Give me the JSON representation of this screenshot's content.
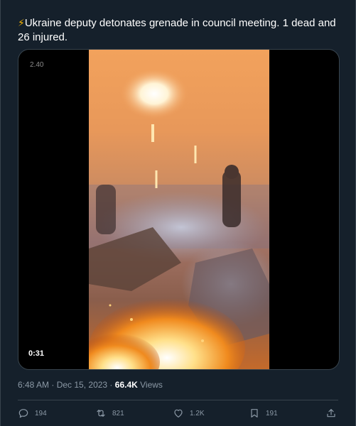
{
  "tweet": {
    "bolt": "⚡",
    "text": "Ukraine deputy detonates grenade in council meeting.  1 dead and 26 injured."
  },
  "media": {
    "watermark": "2.40",
    "duration": "0:31"
  },
  "meta": {
    "time": "6:48 AM",
    "sep1": " · ",
    "date": "Dec 15, 2023",
    "sep2": " · ",
    "views_count": "66.4K",
    "views_label": " Views"
  },
  "actions": {
    "replies": "194",
    "reposts": "821",
    "likes": "1.2K",
    "bookmarks": "191"
  },
  "colors": {
    "background": "#15202b",
    "secondary_text": "#8b98a5",
    "border": "#38444d",
    "bolt": "#f5b400"
  }
}
